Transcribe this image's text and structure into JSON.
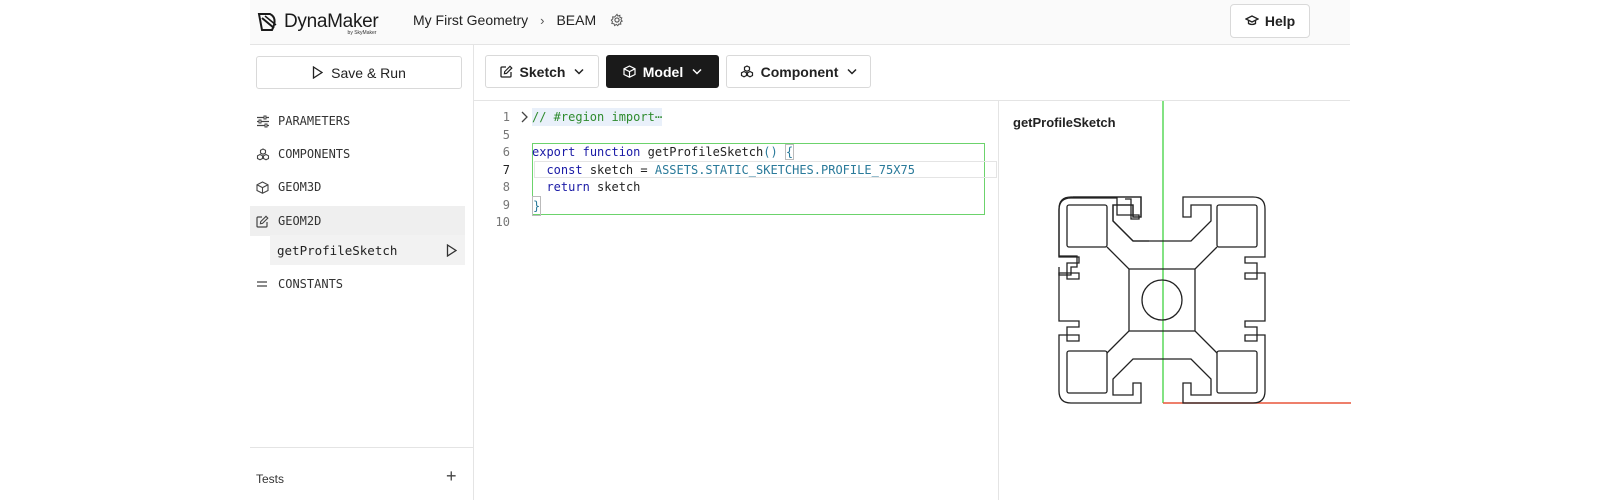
{
  "header": {
    "logo_text": "DynaMaker",
    "logo_sub": "by SkyMaker",
    "crumbs": [
      "My First Geometry",
      "BEAM"
    ],
    "help_label": "Help"
  },
  "sidebar": {
    "save_run_label": "Save & Run",
    "items": [
      {
        "label": "PARAMETERS",
        "icon": "sliders-icon"
      },
      {
        "label": "COMPONENTS",
        "icon": "components-icon"
      },
      {
        "label": "GEOM3D",
        "icon": "cube-icon"
      },
      {
        "label": "GEOM2D",
        "icon": "edit-icon"
      },
      {
        "label": "CONSTANTS",
        "icon": "equals-icon"
      }
    ],
    "sub_item": "getProfileSketch",
    "tests_label": "Tests"
  },
  "toolbar": {
    "sketch": "Sketch",
    "model": "Model",
    "component": "Component"
  },
  "editor": {
    "lines": [
      {
        "n": "1",
        "text": "// #region import⋯"
      },
      {
        "n": "5",
        "text": ""
      },
      {
        "n": "6",
        "text": "export function getProfileSketch() {"
      },
      {
        "n": "7",
        "text": "  const sketch = ASSETS.STATIC_SKETCHES.PROFILE_75X75"
      },
      {
        "n": "8",
        "text": "  return sketch"
      },
      {
        "n": "9",
        "text": "}"
      },
      {
        "n": "10",
        "text": ""
      }
    ],
    "tokens": {
      "comment": "// #region import⋯",
      "export": "export",
      "function": "function",
      "fn_name": "getProfileSketch",
      "parens": "()",
      "brace_open": "{",
      "const": "const",
      "sketch_var": "sketch =",
      "assets": "ASSETS.STATIC_SKETCHES.PROFILE_75X75",
      "return": "return",
      "sketch_ret": "sketch",
      "brace_close": "}"
    }
  },
  "viewer": {
    "title": "getProfileSketch",
    "axis_x_color": "#e8553a",
    "axis_y_color": "#5ad85a"
  },
  "colors": {
    "accent_dark": "#1a1a1a",
    "block_border": "#6cd36c"
  }
}
